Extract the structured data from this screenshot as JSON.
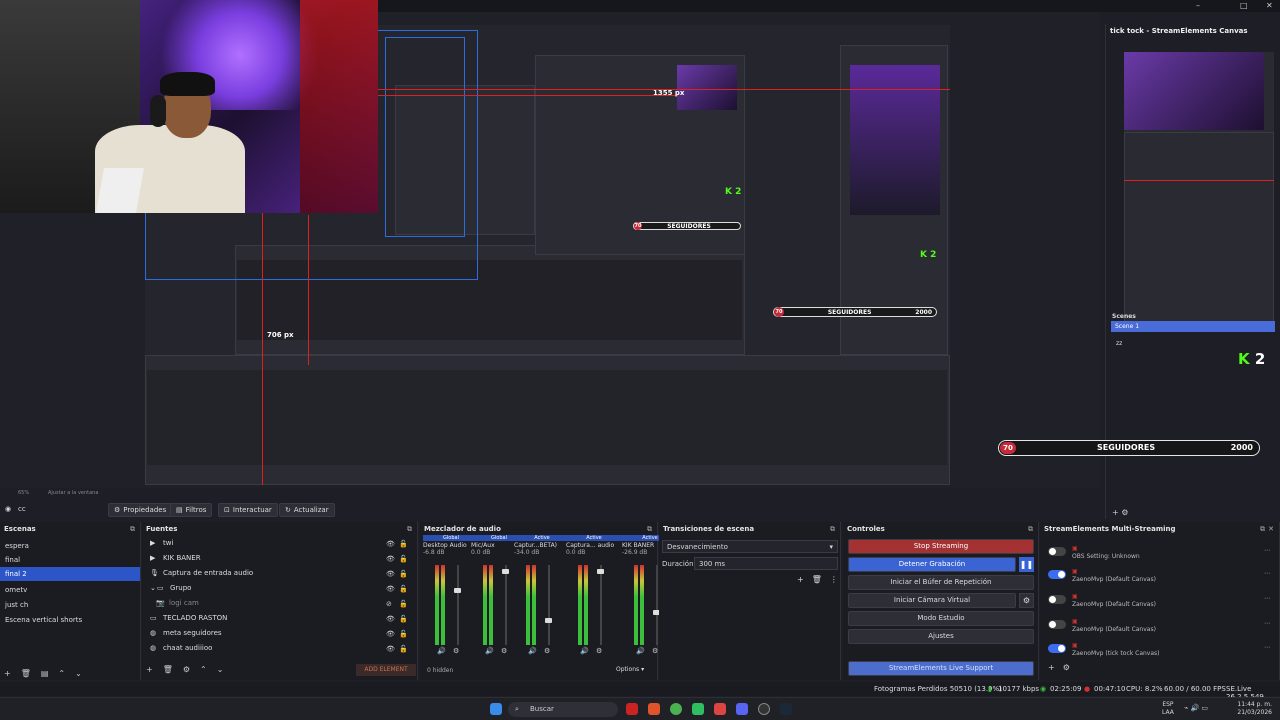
{
  "window": {
    "canvas_panel_title": "tick tock - StreamElements Canvas"
  },
  "preview": {
    "px_label_top": "1355 px",
    "px_label_bottom": "706 px",
    "nested_k2": "2",
    "nested_follow": {
      "count": "70",
      "label": "SEGUIDORES",
      "goal": "2000"
    }
  },
  "canvas_panel": {
    "scenes_label": "Scenes",
    "selected_scene": "Scene 1",
    "item": "zz",
    "k_logo": "K",
    "k_value": "2"
  },
  "follow_bar": {
    "count": "70",
    "label": "SEGUIDORES",
    "goal": "2000"
  },
  "zoom": {
    "percent": "65%",
    "mode": "Ajustar a la ventana"
  },
  "toolbar": {
    "selected_source": "cc",
    "properties": "Propiedades",
    "filters": "Filtros",
    "interact": "Interactuar",
    "refresh": "Actualizar"
  },
  "scenes": {
    "title": "Escenas",
    "items": [
      "espera",
      "final",
      "final 2",
      "ometv",
      "just ch",
      "Escena vertical shorts"
    ],
    "selected_index": 2
  },
  "sources": {
    "title": "Fuentes",
    "items": [
      {
        "name": "twi",
        "icon": "play-icon"
      },
      {
        "name": "KIK BANER",
        "icon": "play-icon"
      },
      {
        "name": "Captura de entrada audio",
        "icon": "mic-icon"
      },
      {
        "name": "Grupo",
        "icon": "folder-icon"
      },
      {
        "name": "logi cam",
        "icon": "camera-icon"
      },
      {
        "name": "TECLADO RASTON",
        "icon": "display-icon"
      },
      {
        "name": "meta seguidores",
        "icon": "globe-icon"
      },
      {
        "name": "chaat audiiioo",
        "icon": "globe-icon"
      }
    ],
    "add_element": "ADD ELEMENT"
  },
  "mixer": {
    "title": "Mezclador de audio",
    "channels": [
      {
        "header": "Global",
        "name": "Desktop Audio",
        "db": "-6.8 dB",
        "level": 0.7
      },
      {
        "header": "Global",
        "name": "Mic/Aux",
        "db": "0.0 dB",
        "level": 0.95
      },
      {
        "header": "Active",
        "name": "Captur...BETA)",
        "db": "-34.0 dB",
        "level": 0.3
      },
      {
        "header": "Active",
        "name": "Captura... audio",
        "db": "0.0 dB",
        "level": 0.95
      },
      {
        "header": "Active",
        "name": "KIK BANER",
        "db": "-26.9 dB",
        "level": 0.4
      }
    ],
    "hidden": "0 hidden",
    "options": "Options"
  },
  "transitions": {
    "title": "Transiciones de escena",
    "selected": "Desvanecimiento",
    "duration_label": "Duración",
    "duration_value": "300 ms"
  },
  "controls": {
    "title": "Controles",
    "stop_streaming": "Stop Streaming",
    "stop_recording": "Detener Grabación",
    "replay_buffer": "Iniciar el Búfer de Repetición",
    "virtual_cam": "Iniciar Cámara Virtual",
    "studio_mode": "Modo Estudio",
    "settings": "Ajustes",
    "live_support": "StreamElements Live Support"
  },
  "multistream": {
    "title": "StreamElements Multi-Streaming",
    "rows": [
      {
        "text": "OBS Setting: Unknown",
        "on": false
      },
      {
        "text": "ZaenoMvp (Default Canvas)",
        "on": true
      },
      {
        "text": "ZaenoMvp (Default Canvas)",
        "on": false
      },
      {
        "text": "ZaenoMvp (Default Canvas)",
        "on": false
      },
      {
        "text": "ZaenoMvp (tick tock Canvas)",
        "on": true
      }
    ]
  },
  "status": {
    "dropped_frames": "Fotogramas Perdidos 50510 (13.9%)",
    "bitrate": "10177 kbps",
    "stream_time": "02:25:09",
    "rec_time": "00:47:10",
    "cpu": "CPU: 8.2%",
    "fps": "60.00 / 60.00 FPS",
    "version": "SE.Live 26.2.5.549"
  },
  "taskbar": {
    "search": "Buscar",
    "lang_top": "ESP",
    "lang_bottom": "LAA",
    "time": "11:44 p. m.",
    "date": "21/03/2026"
  },
  "colors": {
    "accent": "#2c55c7",
    "stop": "#a53232",
    "kick_green": "#53fc18",
    "follow_red": "#c42a3a"
  }
}
